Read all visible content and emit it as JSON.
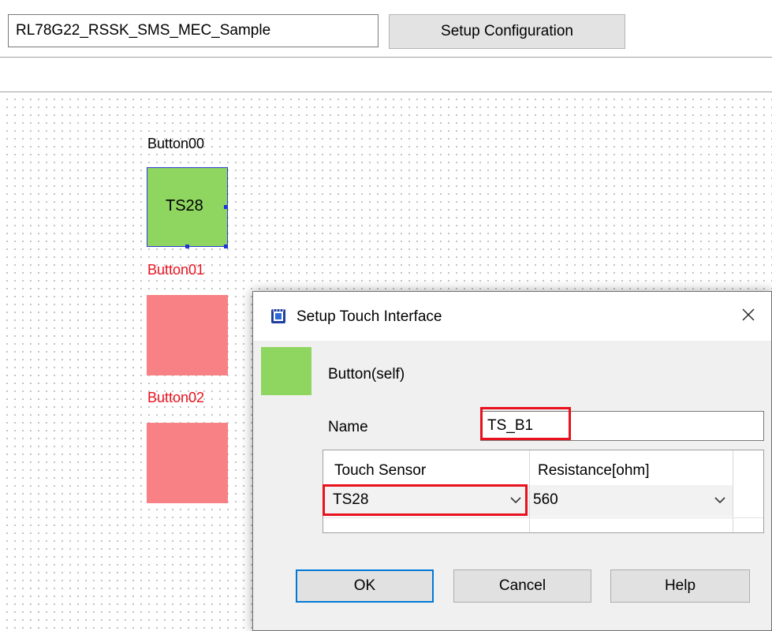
{
  "toolbar": {
    "project_name": "RL78G22_RSSK_SMS_MEC_Sample",
    "setup_config_label": "Setup Configuration"
  },
  "canvas": {
    "buttons": [
      {
        "label": "Button00",
        "sensor": "TS28",
        "state": "configured",
        "label_color": "#000000",
        "fill": "#8ed65f"
      },
      {
        "label": "Button01",
        "state": "unconfigured",
        "label_color": "#e8121e",
        "fill": "#f78184"
      },
      {
        "label": "Button02",
        "state": "unconfigured",
        "label_color": "#e8121e",
        "fill": "#f78184"
      }
    ]
  },
  "dialog": {
    "title": "Setup Touch Interface",
    "type_label": "Button(self)",
    "name_label": "Name",
    "name_value": "TS_B1",
    "table": {
      "headers": [
        "Touch Sensor",
        "Resistance[ohm]"
      ],
      "row": {
        "touch_sensor": "TS28",
        "resistance": "560"
      }
    },
    "buttons": {
      "ok": "OK",
      "cancel": "Cancel",
      "help": "Help"
    }
  },
  "icons": {
    "app": "chip-icon",
    "close": "close-icon",
    "dropdown": "chevron-down-icon"
  },
  "colors": {
    "highlight": "#e8121e",
    "configured": "#8ed65f",
    "unconfigured": "#f78184",
    "accent": "#0078d7"
  }
}
